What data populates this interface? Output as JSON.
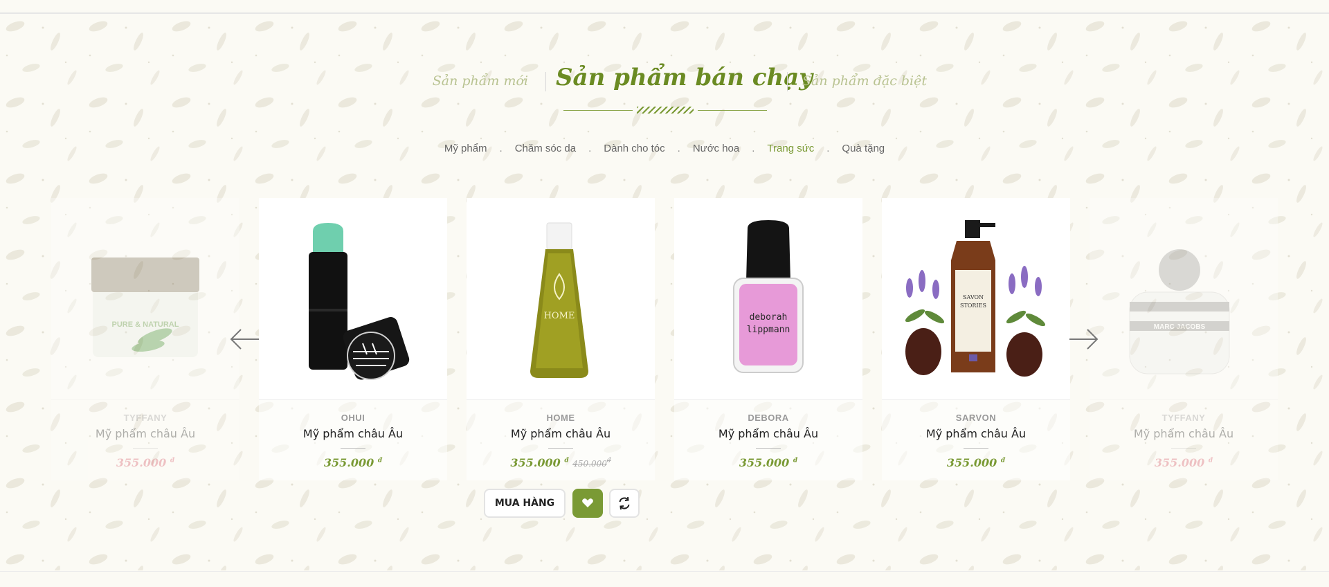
{
  "section_tabs": {
    "left": "Sản phẩm mới",
    "active": "Sản phẩm bán chạy",
    "right": "Sản phẩm đặc biệt"
  },
  "categories": [
    {
      "label": "Mỹ phẩm",
      "active": false
    },
    {
      "label": "Chăm sóc da",
      "active": false
    },
    {
      "label": "Dành cho tóc",
      "active": false
    },
    {
      "label": "Nước hoa",
      "active": false
    },
    {
      "label": "Trang sức",
      "active": true
    },
    {
      "label": "Quà tặng",
      "active": false
    }
  ],
  "separator": ".",
  "currency": "đ",
  "products": [
    {
      "brand": "TYFFANY",
      "name": "Mỹ phẩm châu Âu",
      "price": "355.000",
      "old_price": "",
      "image_label": "PURE & NATURAL",
      "faded": true
    },
    {
      "brand": "OHUI",
      "name": "Mỹ phẩm châu Âu",
      "price": "355.000",
      "old_price": "",
      "faded": false
    },
    {
      "brand": "HOME",
      "name": "Mỹ phẩm châu Âu",
      "price": "355.000",
      "old_price": "450.000",
      "image_label": "HOME",
      "faded": false
    },
    {
      "brand": "DEBORA",
      "name": "Mỹ phẩm châu Âu",
      "price": "355.000",
      "old_price": "",
      "image_label": "deborah lippmann",
      "faded": false
    },
    {
      "brand": "SARVON",
      "name": "Mỹ phẩm châu Âu",
      "price": "355.000",
      "old_price": "",
      "image_label": "SAVON STORIES",
      "faded": false
    },
    {
      "brand": "TYFFANY",
      "name": "Mỹ phẩm châu Âu",
      "price": "355.000",
      "old_price": "",
      "image_label": "MARC JACOBS",
      "faded": true
    }
  ],
  "actions": {
    "buy_label": "MUA HÀNG",
    "wishlist_icon": "heart-icon",
    "compare_icon": "refresh-icon"
  },
  "colors": {
    "accent": "#7a9a35",
    "muted_accent": "#b9c392",
    "sale_price_faded": "#d85a6a"
  }
}
